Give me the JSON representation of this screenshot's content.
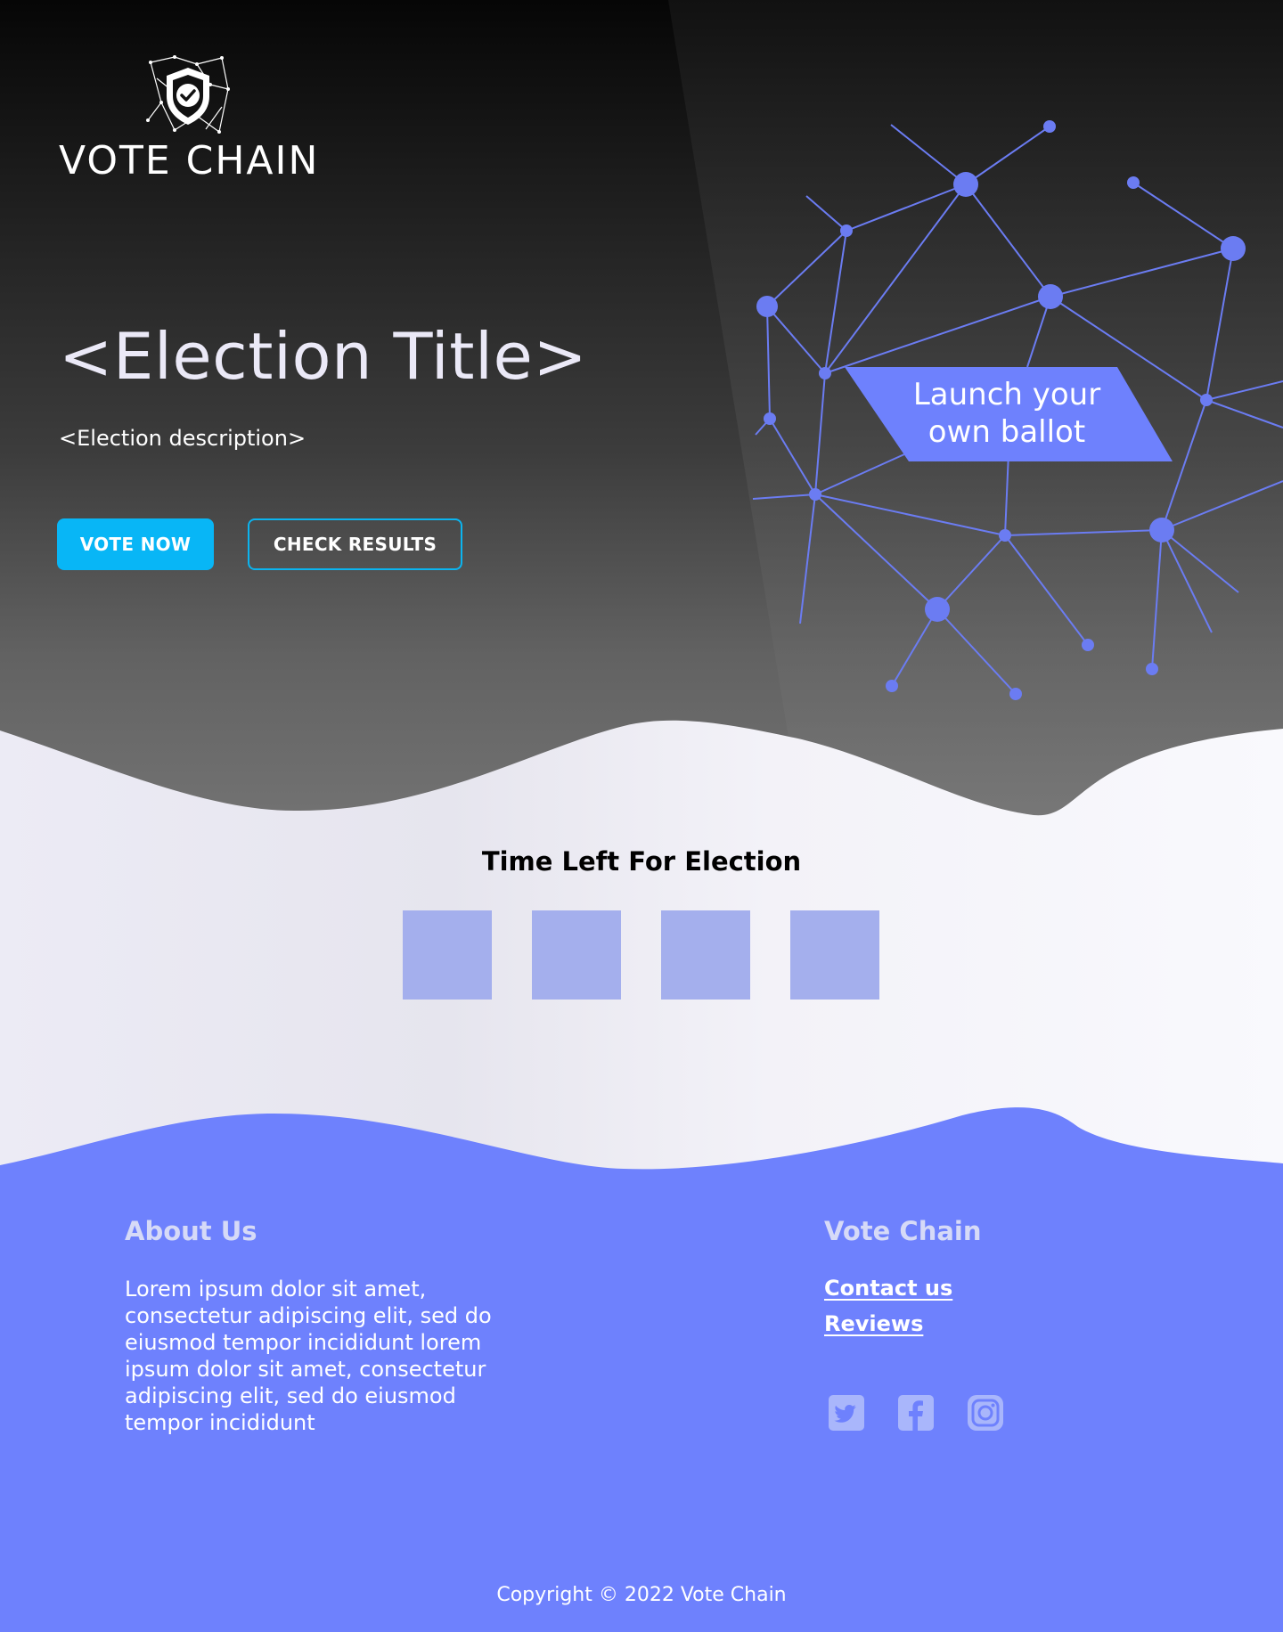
{
  "brand": {
    "name": "VOTE CHAIN"
  },
  "hero": {
    "title": "<Election Title>",
    "description": "<Election description>",
    "vote_button": "VOTE NOW",
    "results_button": "CHECK RESULTS",
    "launch_line1": "Launch your",
    "launch_line2": "own ballot"
  },
  "timer": {
    "title": "Time Left For Election",
    "boxes": [
      "",
      "",
      "",
      ""
    ]
  },
  "footer": {
    "about_title": "About Us",
    "about_text": "Lorem ipsum dolor sit amet, consectetur adipiscing elit, sed do eiusmod tempor incididunt lorem ipsum dolor sit amet, consectetur adipiscing elit, sed do eiusmod tempor incididunt",
    "brand_title": "Vote Chain",
    "contact_link": "Contact us",
    "reviews_link": "Reviews",
    "social": [
      "twitter-icon",
      "facebook-icon",
      "instagram-icon"
    ],
    "copyright": "Copyright © 2022 Vote Chain"
  },
  "colors": {
    "accent_blue": "#08b6f6",
    "network_blue": "#6b7cf2",
    "footer_bg": "#6e81fd",
    "timer_box": "#a4afed"
  }
}
